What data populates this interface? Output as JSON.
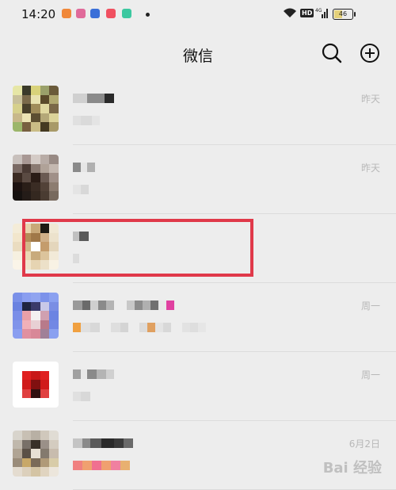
{
  "status_bar": {
    "time": "14:20",
    "hd_label": "HD",
    "network_label": "4G",
    "battery": "46",
    "app_icon_colors": [
      "#f0883a",
      "#e06a9a",
      "#3a6fd8",
      "#f05060",
      "#3cc8a0"
    ]
  },
  "header": {
    "title": "微信",
    "search_icon": "search-icon",
    "add_icon": "plus-circle-icon"
  },
  "chats": [
    {
      "time": "昨天",
      "avatar_colors": [
        "#e6e6a6",
        "#3a3a2a",
        "#d8d27a",
        "#9aa06a",
        "#6a5a3a",
        "#c8c09a",
        "#7a6a4a",
        "#e8e2b0",
        "#5a4a2a",
        "#b0a870",
        "#d6d08c",
        "#48402a",
        "#a08c5a",
        "#e0d8a0",
        "#7a6848",
        "#c8b88a",
        "#ece4b4",
        "#5c4e32",
        "#b4a878",
        "#dcd49a",
        "#9cb66a",
        "#786040",
        "#cabc86",
        "#443a22",
        "#a89a68"
      ],
      "name_blocks": [
        {
          "w": 18,
          "c": "#d0d0d0"
        },
        {
          "w": 22,
          "c": "#8a8a8a"
        },
        {
          "w": 12,
          "c": "#2a2a2a"
        }
      ],
      "preview_blocks": [
        {
          "w": 10,
          "c": "#e0e0e0"
        },
        {
          "w": 14,
          "c": "#dadada"
        },
        {
          "w": 10,
          "c": "#e4e4e4"
        }
      ]
    },
    {
      "time": "昨天",
      "avatar_colors": [
        "#c8c0bc",
        "#a89894",
        "#d4cbc6",
        "#b8aca6",
        "#988a84",
        "#7a6a64",
        "#4a3a34",
        "#8a7a72",
        "#b0a298",
        "#c4b8b0",
        "#3a2a22",
        "#5a4a42",
        "#2a1c16",
        "#6a5a52",
        "#a09088",
        "#1c1210",
        "#2a1e18",
        "#3a2c24",
        "#524238",
        "#8c7c70",
        "#161210",
        "#241c18",
        "#342820",
        "#4a3c32",
        "#786a5e"
      ],
      "name_blocks": [
        {
          "w": 10,
          "c": "#8a8a8a"
        },
        {
          "w": 8,
          "c": "#e6e6e6"
        },
        {
          "w": 10,
          "c": "#b0b0b0"
        }
      ],
      "preview_blocks": [
        {
          "w": 10,
          "c": "#e4e4e4"
        },
        {
          "w": 10,
          "c": "#d8d8d8"
        }
      ]
    },
    {
      "time": "",
      "avatar_colors": [
        "#f4ecd8",
        "#e8d4ac",
        "#c8a878",
        "#1e1a14",
        "#f0e8d4",
        "#f2e6cc",
        "#b48c58",
        "#a07848",
        "#d0b088",
        "#ece2cc",
        "#eadcc0",
        "#d2b888",
        "#ffffff",
        "#c49c6c",
        "#e4d6bc",
        "#f6f0e0",
        "#ead8b4",
        "#c8aa7c",
        "#dcc49c",
        "#f2ead8",
        "#faf4e8",
        "#f0e4cc",
        "#e6d4b2",
        "#ece0c8",
        "#f8f2e4"
      ],
      "name_blocks": [
        {
          "w": 8,
          "c": "#c0c0c0"
        },
        {
          "w": 12,
          "c": "#5a5a5a"
        }
      ],
      "preview_blocks": [
        {
          "w": 8,
          "c": "#dcdcdc"
        }
      ]
    },
    {
      "time": "周一",
      "avatar_colors": [
        "#7a90e8",
        "#8a9ef0",
        "#90a4f0",
        "#7c92ea",
        "#8aa0f0",
        "#6a82e0",
        "#1e2440",
        "#3a3a6a",
        "#c8c8e8",
        "#7a8ee4",
        "#7a8ee8",
        "#e8a0a8",
        "#f4f0f0",
        "#d0a0b0",
        "#6c84e2",
        "#8094ea",
        "#f0b0b8",
        "#e8d0d4",
        "#b87a8a",
        "#7288e4",
        "#8a9ef0",
        "#e090a0",
        "#d88898",
        "#a08098",
        "#8aa0f0"
      ],
      "name_blocks": [
        {
          "w": 12,
          "c": "#9a9a9a"
        },
        {
          "w": 10,
          "c": "#6a6a6a"
        },
        {
          "w": 10,
          "c": "#cfcfcf"
        },
        {
          "w": 10,
          "c": "#8a8a8a"
        },
        {
          "w": 10,
          "c": "#b4b4b4"
        },
        {
          "w": 16,
          "c": "#ededed"
        },
        {
          "w": 10,
          "c": "#c8c8c8"
        },
        {
          "w": 10,
          "c": "#8c8c8c"
        },
        {
          "w": 10,
          "c": "#b0b0b0"
        },
        {
          "w": 10,
          "c": "#707070"
        },
        {
          "w": 10,
          "c": "#e8e8e8"
        },
        {
          "w": 10,
          "c": "#e040a0"
        }
      ],
      "preview_blocks": [
        {
          "w": 10,
          "c": "#f0a040"
        },
        {
          "w": 12,
          "c": "#e0e0e0"
        },
        {
          "w": 12,
          "c": "#d8d8d8"
        },
        {
          "w": 14,
          "c": "#ededed"
        },
        {
          "w": 12,
          "c": "#dedede"
        },
        {
          "w": 10,
          "c": "#d4d4d4"
        },
        {
          "w": 14,
          "c": "#ededed"
        },
        {
          "w": 10,
          "c": "#dcdcdc"
        },
        {
          "w": 10,
          "c": "#e0a060"
        },
        {
          "w": 10,
          "c": "#e4e4e4"
        },
        {
          "w": 10,
          "c": "#d8d8d8"
        },
        {
          "w": 14,
          "c": "#ededed"
        },
        {
          "w": 10,
          "c": "#e2e2e2"
        },
        {
          "w": 10,
          "c": "#dedede"
        },
        {
          "w": 10,
          "c": "#e6e6e6"
        }
      ]
    },
    {
      "time": "周一",
      "avatar_colors": [
        "#ffffff",
        "#ffffff",
        "#ffffff",
        "#ffffff",
        "#ffffff",
        "#ffffff",
        "#e02020",
        "#c81818",
        "#e02020",
        "#ffffff",
        "#ffffff",
        "#d01a1a",
        "#801010",
        "#d01a1a",
        "#ffffff",
        "#ffffff",
        "#e04040",
        "#301010",
        "#e04040",
        "#ffffff",
        "#ffffff",
        "#ffffff",
        "#ffffff",
        "#ffffff",
        "#ffffff"
      ],
      "name_blocks": [
        {
          "w": 10,
          "c": "#a0a0a0"
        },
        {
          "w": 8,
          "c": "#e8e8e8"
        },
        {
          "w": 12,
          "c": "#8a8a8a"
        },
        {
          "w": 12,
          "c": "#b4b4b4"
        },
        {
          "w": 10,
          "c": "#d0d0d0"
        }
      ],
      "preview_blocks": [
        {
          "w": 10,
          "c": "#e0e0e0"
        },
        {
          "w": 12,
          "c": "#d8d8d8"
        }
      ]
    },
    {
      "time": "6月2日",
      "avatar_colors": [
        "#d8d4cc",
        "#c8c0b4",
        "#b8b0a4",
        "#d0c8bc",
        "#e0dcd4",
        "#c0b8ac",
        "#787068",
        "#383028",
        "#9a9088",
        "#d4ccc0",
        "#b0a494",
        "#5a5046",
        "#e8e0d4",
        "#847a6e",
        "#c8bcae",
        "#9a8c7a",
        "#c8a868",
        "#7a6a58",
        "#b09a78",
        "#d8cca8",
        "#e4dcd0",
        "#dcd0bc",
        "#d4c4a4",
        "#e0d4c0",
        "#ece6dc"
      ],
      "name_blocks": [
        {
          "w": 12,
          "c": "#c4c4c4"
        },
        {
          "w": 10,
          "c": "#8a8a8a"
        },
        {
          "w": 14,
          "c": "#5a5a5a"
        },
        {
          "w": 16,
          "c": "#2a2a2a"
        },
        {
          "w": 12,
          "c": "#3a3a3a"
        },
        {
          "w": 12,
          "c": "#6a6a6a"
        }
      ],
      "preview_blocks": [
        {
          "w": 12,
          "c": "#f08080"
        },
        {
          "w": 12,
          "c": "#f0a070"
        },
        {
          "w": 12,
          "c": "#f07090"
        },
        {
          "w": 12,
          "c": "#f0a070"
        },
        {
          "w": 12,
          "c": "#f080a0"
        },
        {
          "w": 12,
          "c": "#e8b070"
        }
      ]
    }
  ],
  "watermark": "Bai 经验"
}
